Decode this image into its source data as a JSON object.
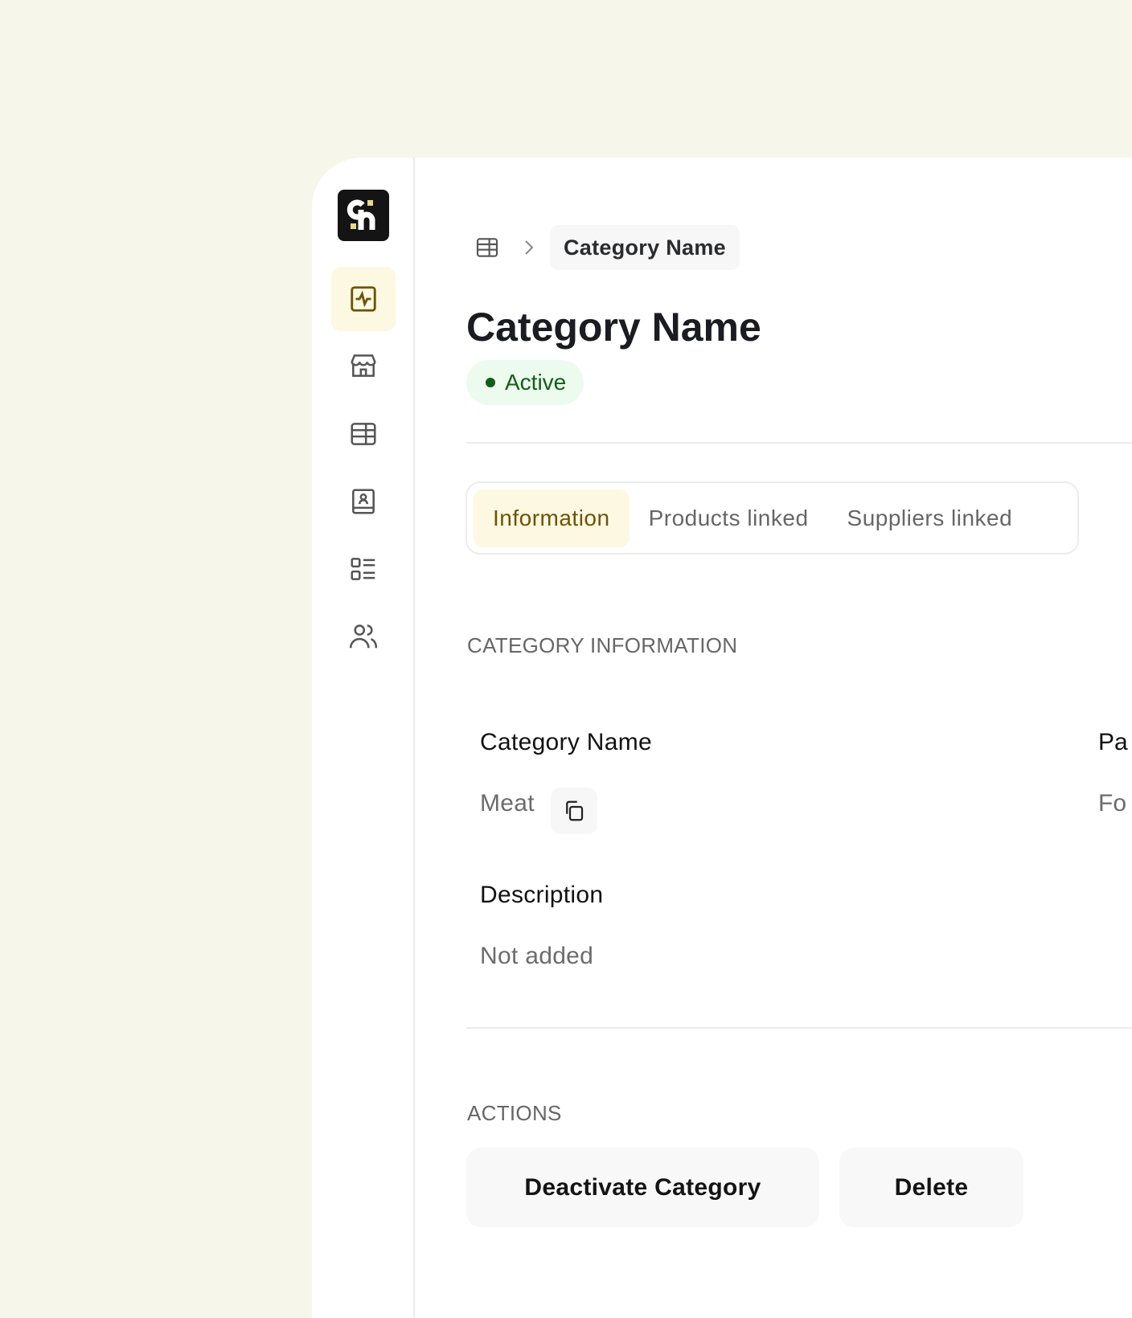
{
  "breadcrumb": {
    "current": "Category Name"
  },
  "header": {
    "title": "Category Name",
    "status": "Active"
  },
  "tabs": [
    {
      "label": "Information",
      "active": true
    },
    {
      "label": "Products linked"
    },
    {
      "label": "Suppliers linked"
    }
  ],
  "info": {
    "section_title": "CATEGORY INFORMATION",
    "fields": [
      {
        "label": "Category Name",
        "value": "Meat"
      },
      {
        "label": "Pa",
        "value": "Fo"
      },
      {
        "label": "Description",
        "value": "Not added"
      }
    ]
  },
  "actions": {
    "section_title": "ACTIONS",
    "deactivate": "Deactivate Category",
    "delete": "Delete"
  },
  "colors": {
    "background": "#f6f6ea",
    "accent_bg": "#fdf8e1",
    "accent_text": "#6b5308",
    "active_green": "#135c1a"
  }
}
